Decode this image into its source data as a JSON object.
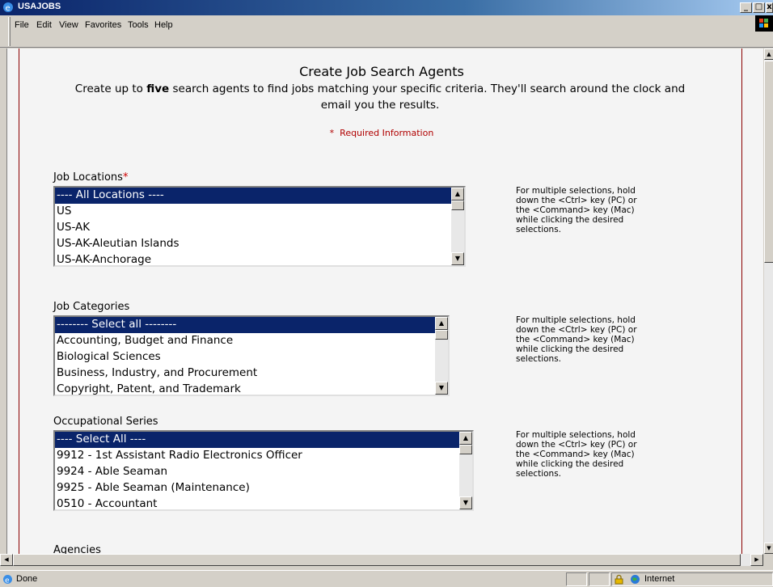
{
  "window": {
    "title": "USAJOBS"
  },
  "menu": [
    "File",
    "Edit",
    "View",
    "Favorites",
    "Tools",
    "Help"
  ],
  "page": {
    "heading": "Create Job Search Agents",
    "intro_before": "Create up to ",
    "intro_bold": "five",
    "intro_after": " search agents to find jobs matching your specific criteria. They'll search around the clock and email you the results.",
    "required_star": "*",
    "required_text": "Required Information",
    "hint": "For multiple selections, hold down the <Ctrl> key (PC) or the <Command> key (Mac) while clicking the desired selections.",
    "sections": [
      {
        "label": "Job Locations",
        "required": true,
        "options": [
          "---- All Locations ----",
          "US",
          "US-AK",
          "US-AK-Aleutian Islands",
          "US-AK-Anchorage"
        ],
        "selected_index": 0
      },
      {
        "label": "Job Categories",
        "required": false,
        "options": [
          "-------- Select all --------",
          "Accounting, Budget and Finance",
          "Biological Sciences",
          "Business, Industry, and Procurement",
          "Copyright, Patent, and Trademark"
        ],
        "selected_index": 0
      },
      {
        "label": "Occupational Series",
        "required": false,
        "options": [
          "---- Select All ----",
          "9912 - 1st Assistant Radio Electronics Officer",
          "9924 - Able Seaman",
          "9925 - Able Seaman (Maintenance)",
          "0510 - Accountant"
        ],
        "selected_index": 0
      }
    ],
    "next_label": "Agencies"
  },
  "status": {
    "text": "Done",
    "zone": "Internet"
  },
  "colors": {
    "title_start": "#0a246a",
    "selection": "#0a246a",
    "rule": "#8b0000",
    "required": "#b00000"
  }
}
